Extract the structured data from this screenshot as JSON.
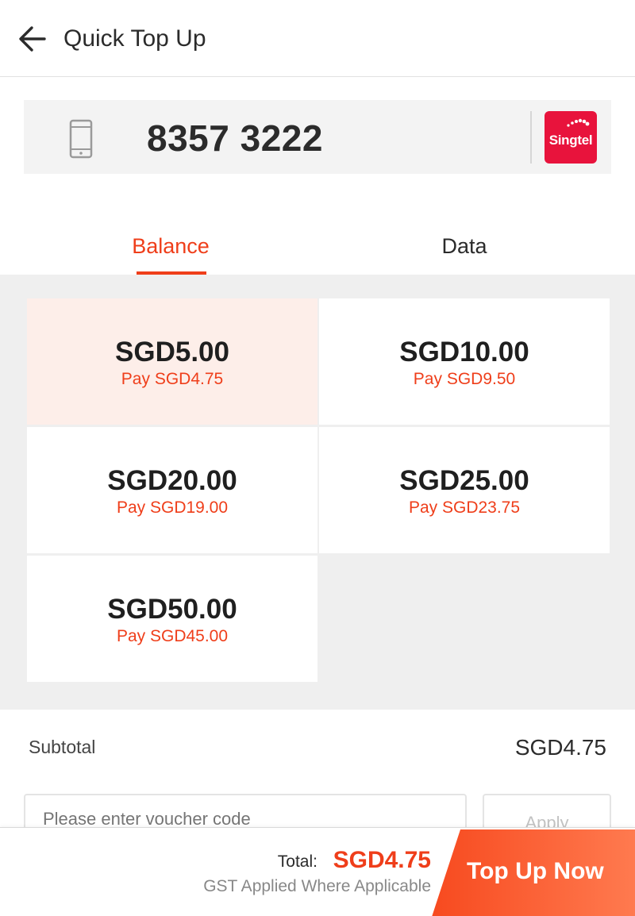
{
  "header": {
    "title": "Quick Top Up"
  },
  "phone": {
    "number": "8357 3222",
    "operator_logo_text": "Singtel"
  },
  "tabs": [
    {
      "label": "Balance",
      "active": true
    },
    {
      "label": "Data",
      "active": false
    }
  ],
  "denominations": [
    {
      "amount": "SGD5.00",
      "pay": "Pay SGD4.75",
      "selected": true
    },
    {
      "amount": "SGD10.00",
      "pay": "Pay SGD9.50",
      "selected": false
    },
    {
      "amount": "SGD20.00",
      "pay": "Pay SGD19.00",
      "selected": false
    },
    {
      "amount": "SGD25.00",
      "pay": "Pay SGD23.75",
      "selected": false
    },
    {
      "amount": "SGD50.00",
      "pay": "Pay SGD45.00",
      "selected": false
    }
  ],
  "subtotal": {
    "label": "Subtotal",
    "value": "SGD4.75"
  },
  "voucher": {
    "placeholder": "Please enter voucher code",
    "apply_label": "Apply"
  },
  "footer": {
    "total_label": "Total:",
    "total_value": "SGD4.75",
    "gst_note": "GST Applied Where Applicable",
    "cta_label": "Top Up Now"
  },
  "colors": {
    "accent": "#ef3e1a",
    "selected_bg": "#fdeee9",
    "operator_brand": "#e8133c"
  },
  "icons": {
    "back": "arrow-left-icon",
    "phone": "mobile-phone-icon"
  }
}
